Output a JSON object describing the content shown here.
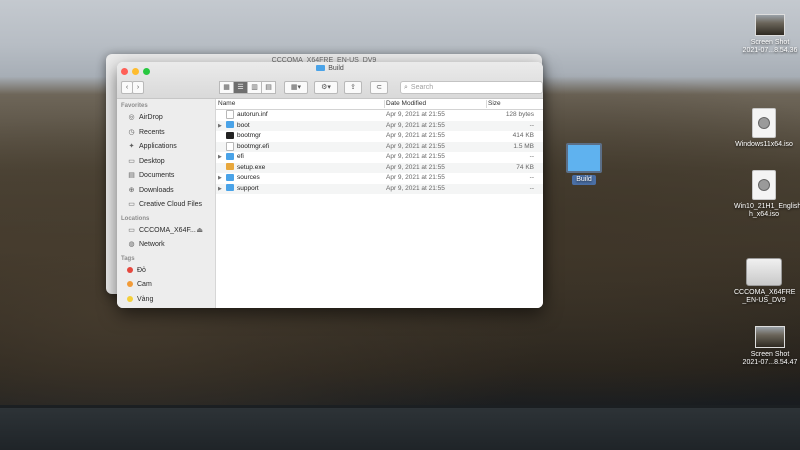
{
  "back_window": {
    "title": "CCCOMA_X64FRE_EN-US_DV9"
  },
  "window": {
    "title": "Build",
    "nav": {
      "back": "‹",
      "forward": "›"
    },
    "view_buttons": [
      "▦",
      "☰",
      "▥",
      "▤"
    ],
    "group_button": "▦▾",
    "action_button": "⚙▾",
    "share_button": "⇪",
    "tag_button": "⊂",
    "search_placeholder": "Search",
    "sidebar": {
      "favorites_header": "Favorites",
      "favorites": [
        {
          "label": "AirDrop",
          "icon": "airdrop-icon",
          "glyph": "◎"
        },
        {
          "label": "Recents",
          "icon": "clock-icon",
          "glyph": "◷"
        },
        {
          "label": "Applications",
          "icon": "applications-icon",
          "glyph": "✦"
        },
        {
          "label": "Desktop",
          "icon": "desktop-icon",
          "glyph": "▭"
        },
        {
          "label": "Documents",
          "icon": "documents-icon",
          "glyph": "▤"
        },
        {
          "label": "Downloads",
          "icon": "downloads-icon",
          "glyph": "⊕"
        },
        {
          "label": "Creative Cloud Files",
          "icon": "folder-icon",
          "glyph": "▭"
        }
      ],
      "locations_header": "Locations",
      "locations": [
        {
          "label": "CCCOMA_X64F...",
          "icon": "disc-icon",
          "glyph": "▭",
          "eject": "⏏"
        },
        {
          "label": "Network",
          "icon": "network-icon",
          "glyph": "◍"
        }
      ],
      "tags_header": "Tags",
      "tags": [
        {
          "label": "Đỏ",
          "color": "#e5483e"
        },
        {
          "label": "Cam",
          "color": "#f29b38"
        },
        {
          "label": "Vàng",
          "color": "#f4cf3a"
        }
      ]
    },
    "columns": {
      "name": "Name",
      "date": "Date Modified",
      "size": "Size"
    },
    "files": [
      {
        "name": "autorun.inf",
        "type": "doc",
        "expand": "",
        "date": "Apr 9, 2021 at 21:55",
        "size": "128 bytes"
      },
      {
        "name": "boot",
        "type": "folder",
        "expand": "▶",
        "date": "Apr 9, 2021 at 21:55",
        "size": "--"
      },
      {
        "name": "bootmgr",
        "type": "exe",
        "expand": "",
        "date": "Apr 9, 2021 at 21:55",
        "size": "414 KB"
      },
      {
        "name": "bootmgr.efi",
        "type": "doc",
        "expand": "",
        "date": "Apr 9, 2021 at 21:55",
        "size": "1.5 MB"
      },
      {
        "name": "efi",
        "type": "folder",
        "expand": "▶",
        "date": "Apr 9, 2021 at 21:55",
        "size": "--"
      },
      {
        "name": "setup.exe",
        "type": "setup",
        "expand": "",
        "date": "Apr 9, 2021 at 21:55",
        "size": "74 KB"
      },
      {
        "name": "sources",
        "type": "folder",
        "expand": "▶",
        "date": "Apr 9, 2021 at 21:55",
        "size": "--"
      },
      {
        "name": "support",
        "type": "folder",
        "expand": "▶",
        "date": "Apr 9, 2021 at 21:55",
        "size": "--"
      }
    ]
  },
  "desktop": {
    "dragged_folder": "Build",
    "icons": [
      {
        "kind": "shot",
        "label1": "Screen Shot",
        "label2": "2021-07...8.54.36"
      },
      {
        "kind": "disc",
        "label1": "Windows11x64.iso",
        "label2": ""
      },
      {
        "kind": "disc",
        "label1": "Win10_21H1_English",
        "label2": "h_x64.iso"
      },
      {
        "kind": "drive",
        "label1": "CCCOMA_X64FRE",
        "label2": "_EN-US_DV9"
      },
      {
        "kind": "shot",
        "label1": "Screen Shot",
        "label2": "2021-07...8.54.47"
      }
    ]
  }
}
